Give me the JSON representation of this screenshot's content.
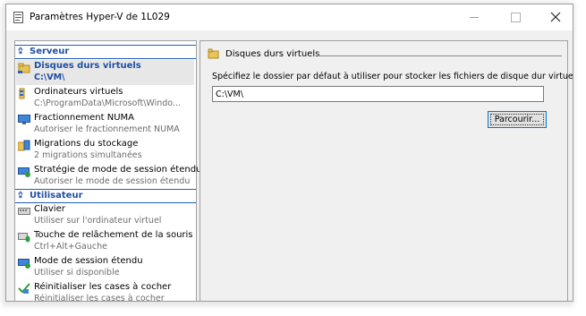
{
  "window": {
    "title": "Paramètres Hyper-V de 1L029",
    "controls": {
      "minimize": "minimize",
      "maximize": "maximize",
      "close": "close"
    }
  },
  "sidebar": {
    "sections": [
      {
        "label": "Serveur",
        "items": [
          {
            "name": "Disques durs virtuels",
            "sub": "C:\\VM\\",
            "icon": "disk-folder-icon",
            "selected": true
          },
          {
            "name": "Ordinateurs virtuels",
            "sub": "C:\\ProgramData\\Microsoft\\Windo...",
            "icon": "vm-folder-icon"
          },
          {
            "name": "Fractionnement NUMA",
            "sub": "Autoriser le fractionnement NUMA",
            "icon": "numa-monitor-icon"
          },
          {
            "name": "Migrations du stockage",
            "sub": "2 migrations simultanées",
            "icon": "storage-migration-icon"
          },
          {
            "name": "Stratégie de mode de session étendu",
            "sub": "Autoriser le mode de session étendu",
            "icon": "session-policy-icon"
          }
        ]
      },
      {
        "label": "Utilisateur",
        "items": [
          {
            "name": "Clavier",
            "sub": "Utiliser sur l'ordinateur virtuel",
            "icon": "keyboard-icon"
          },
          {
            "name": "Touche de relâchement de la souris",
            "sub": "Ctrl+Alt+Gauche",
            "icon": "mouse-release-icon"
          },
          {
            "name": "Mode de session étendu",
            "sub": "Utiliser si disponible",
            "icon": "enhanced-session-icon"
          },
          {
            "name": "Réinitialiser les cases à cocher",
            "sub": "Réinitialiser les cases à cocher",
            "icon": "reset-checkbox-icon"
          }
        ]
      }
    ]
  },
  "panel": {
    "heading": "Disques durs virtuels",
    "description": "Spécifiez le dossier par défaut à utiliser pour stocker les fichiers de disque dur virtuel.",
    "path_value": "C:\\VM\\",
    "browse_label": "Parcourir..."
  },
  "colors": {
    "accent": "#1f4fa0",
    "selection": "#e7e7e7",
    "focus_border": "#0078d7"
  }
}
